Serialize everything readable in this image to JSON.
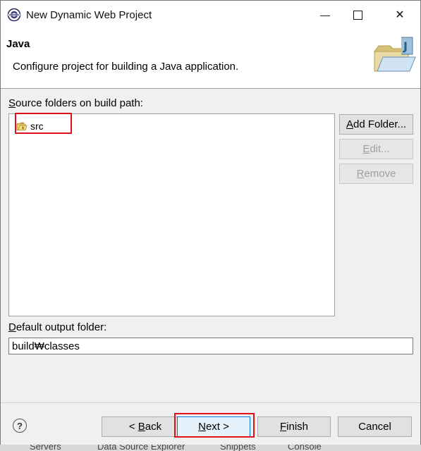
{
  "window": {
    "title": "New Dynamic Web Project",
    "minimize_glyph": "—",
    "maximize_glyph": "☐",
    "close_glyph": "✕"
  },
  "header": {
    "title": "Java",
    "description": "Configure project for building a Java application."
  },
  "source_folders": {
    "label_mnemonic": "S",
    "label_rest": "ource folders on build path:",
    "items": [
      {
        "label": "src",
        "icon": "package-folder-icon"
      }
    ],
    "buttons": {
      "add": {
        "mnemonic": "A",
        "rest": "dd Folder...",
        "enabled": true
      },
      "edit": {
        "mnemonic": "E",
        "rest": "dit...",
        "enabled": false
      },
      "remove": {
        "mnemonic": "R",
        "rest": "emove",
        "enabled": false
      }
    }
  },
  "output_folder": {
    "label_mnemonic": "D",
    "label_rest": "efault output folder:",
    "value": "build₩classes"
  },
  "footer": {
    "help_glyph": "?",
    "back": {
      "prefix": "< ",
      "mnemonic": "B",
      "rest": "ack"
    },
    "next": {
      "mnemonic": "N",
      "rest": "ext >"
    },
    "finish": {
      "mnemonic": "F",
      "rest": "inish"
    },
    "cancel": "Cancel"
  },
  "background_taskbar": [
    "Servers",
    "Data Source Explorer",
    "Snippets",
    "Console"
  ],
  "colors": {
    "highlight_box": "#e0101e",
    "dialog_bg": "#f0f0f0",
    "button_bg": "#e1e1e1"
  }
}
